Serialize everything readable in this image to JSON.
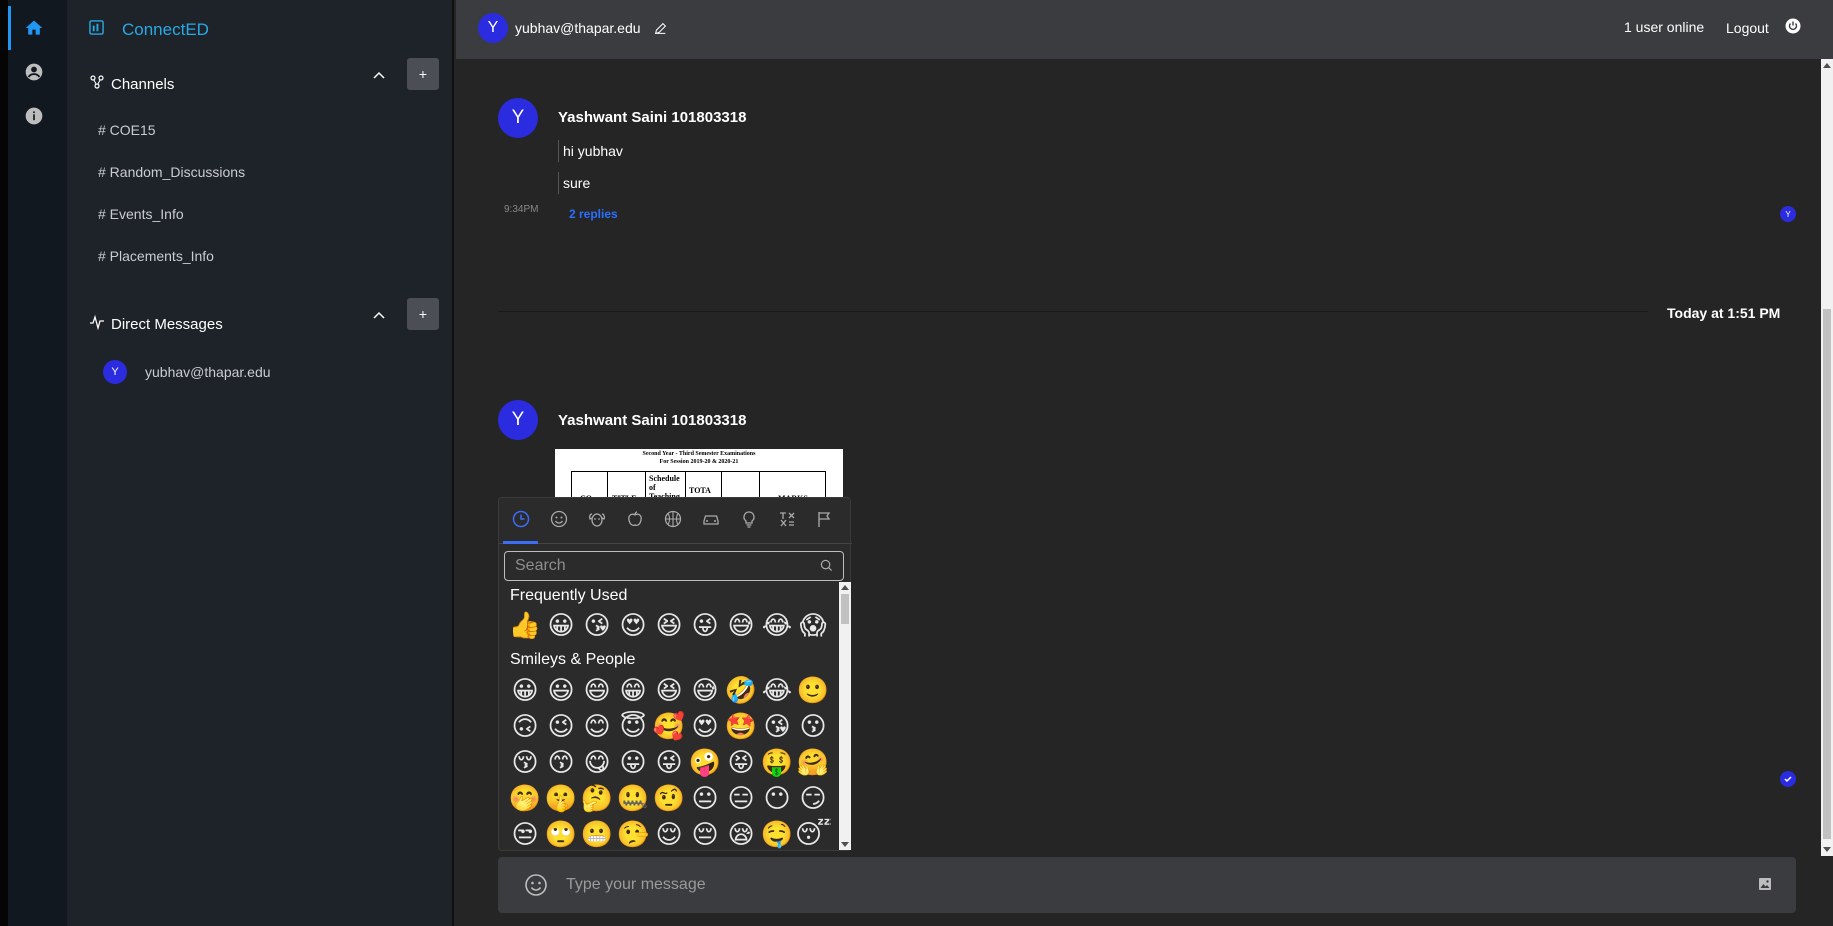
{
  "app": {
    "brand": "ConnectED"
  },
  "rail": {
    "items": [
      {
        "icon": "home-icon"
      },
      {
        "icon": "profile-icon"
      },
      {
        "icon": "info-icon"
      }
    ]
  },
  "sidebar": {
    "channels_title": "Channels",
    "add_label": "+",
    "channels": [
      "# COE15",
      "# Random_Discussions",
      "# Events_Info",
      "# Placements_Info"
    ],
    "dm_title": "Direct Messages",
    "dms": [
      {
        "initial": "Y",
        "name": "yubhav@thapar.edu"
      }
    ]
  },
  "topbar": {
    "initial": "Y",
    "user": "yubhav@thapar.edu",
    "online": "1 user online",
    "logout": "Logout"
  },
  "messages": [
    {
      "initial": "Y",
      "author": "Yashwant Saini 101803318",
      "lines": [
        "hi yubhav",
        "sure"
      ],
      "time": "9:34PM",
      "replies": "2 replies",
      "read_initial": "Y"
    },
    {
      "initial": "Y",
      "author": "Yashwant Saini 101803318",
      "attachment": {
        "line1": "Second Year - Third Semester Examinations",
        "line2": "For Session 2019-20 & 2020-21",
        "headers": [
          "CO",
          "TITLE",
          "Schedule of Teaching",
          "TOTA",
          "",
          "MARKS"
        ]
      }
    }
  ],
  "date_divider": "Today at 1:51 PM",
  "emoji_picker": {
    "categories": [
      "recent-icon",
      "smileys-icon",
      "animals-icon",
      "food-icon",
      "activity-icon",
      "travel-icon",
      "objects-icon",
      "symbols-icon",
      "flags-icon"
    ],
    "search_placeholder": "Search",
    "frequent_title": "Frequently Used",
    "frequent": [
      "👍",
      "😀",
      "😘",
      "😍",
      "😆",
      "😜",
      "😅",
      "😂",
      "😱"
    ],
    "smileys_title": "Smileys & People",
    "smileys": [
      "😀",
      "😃",
      "😄",
      "😁",
      "😆",
      "😅",
      "🤣",
      "😂",
      "🙂",
      "🙃",
      "😉",
      "😊",
      "😇",
      "🥰",
      "😍",
      "🤩",
      "😘",
      "😗",
      "😚",
      "😙",
      "😋",
      "😛",
      "😜",
      "🤪",
      "😝",
      "🤑",
      "🤗",
      "🤭",
      "🤫",
      "🤔",
      "🤐",
      "🤨",
      "😐",
      "😑",
      "😶",
      "😏",
      "😒",
      "🙄",
      "😬",
      "🤥",
      "😌",
      "😔",
      "😪",
      "🤤",
      "😴"
    ]
  },
  "composer": {
    "placeholder": "Type your message"
  },
  "colors": {
    "accent": "#27a9e6",
    "avatar": "#2b2bdf",
    "link": "#2b6fff"
  }
}
